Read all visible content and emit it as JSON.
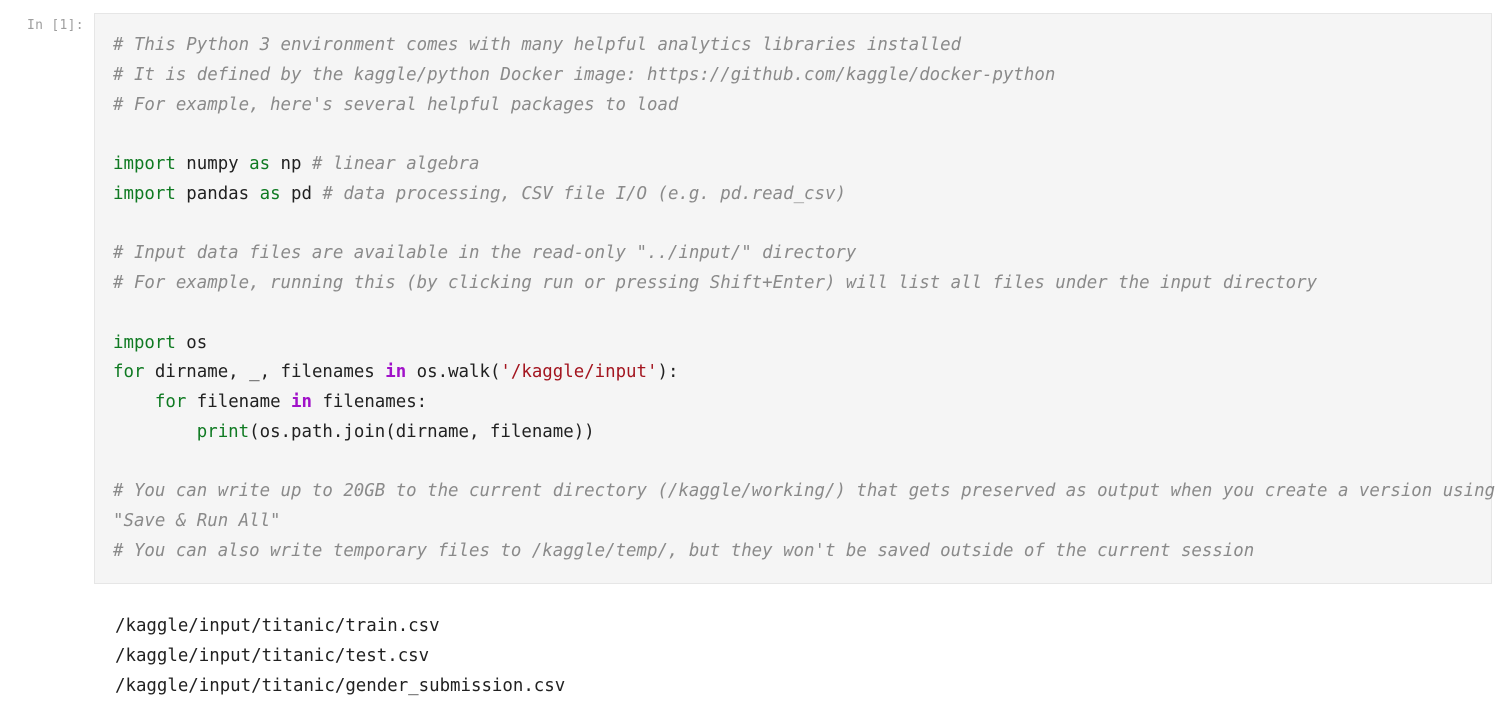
{
  "cell": {
    "prompt": "In [1]:",
    "code": {
      "comment_1": "# This Python 3 environment comes with many helpful analytics libraries installed",
      "comment_2": "# It is defined by the kaggle/python Docker image: https://github.com/kaggle/docker-python",
      "comment_3": "# For example, here's several helpful packages to load",
      "import_numpy": {
        "kw_import": "import",
        "module": " numpy ",
        "kw_as": "as",
        "alias": " np ",
        "comment": "# linear algebra"
      },
      "import_pandas": {
        "kw_import": "import",
        "module": " pandas ",
        "kw_as": "as",
        "alias": " pd ",
        "comment": "# data processing, CSV file I/O (e.g. pd.read_csv)"
      },
      "comment_4": "# Input data files are available in the read-only \"../input/\" directory",
      "comment_5": "# For example, running this (by clicking run or pressing Shift+Enter) will list all files under the input directory",
      "import_os": {
        "kw_import": "import",
        "module": " os"
      },
      "for_outer": {
        "kw_for": "for",
        "vars": " dirname, _, filenames ",
        "kw_in": "in",
        "call": " os.walk(",
        "arg": "'/kaggle/input'",
        "end": "):"
      },
      "for_inner": {
        "indent": "    ",
        "kw_for": "for",
        "var": " filename ",
        "kw_in": "in",
        "rest": " filenames:"
      },
      "print_line": {
        "indent": "        ",
        "func": "print",
        "args": "(os.path.join(dirname, filename))"
      },
      "comment_6": "# You can write up to 20GB to the current directory (/kaggle/working/) that gets preserved as output when you create a version using",
      "comment_6_cont": "\"Save & Run All\"",
      "comment_7": "# You can also write temporary files to /kaggle/temp/, but they won't be saved outside of the current session"
    },
    "output": [
      "/kaggle/input/titanic/train.csv",
      "/kaggle/input/titanic/test.csv",
      "/kaggle/input/titanic/gender_submission.csv"
    ]
  }
}
